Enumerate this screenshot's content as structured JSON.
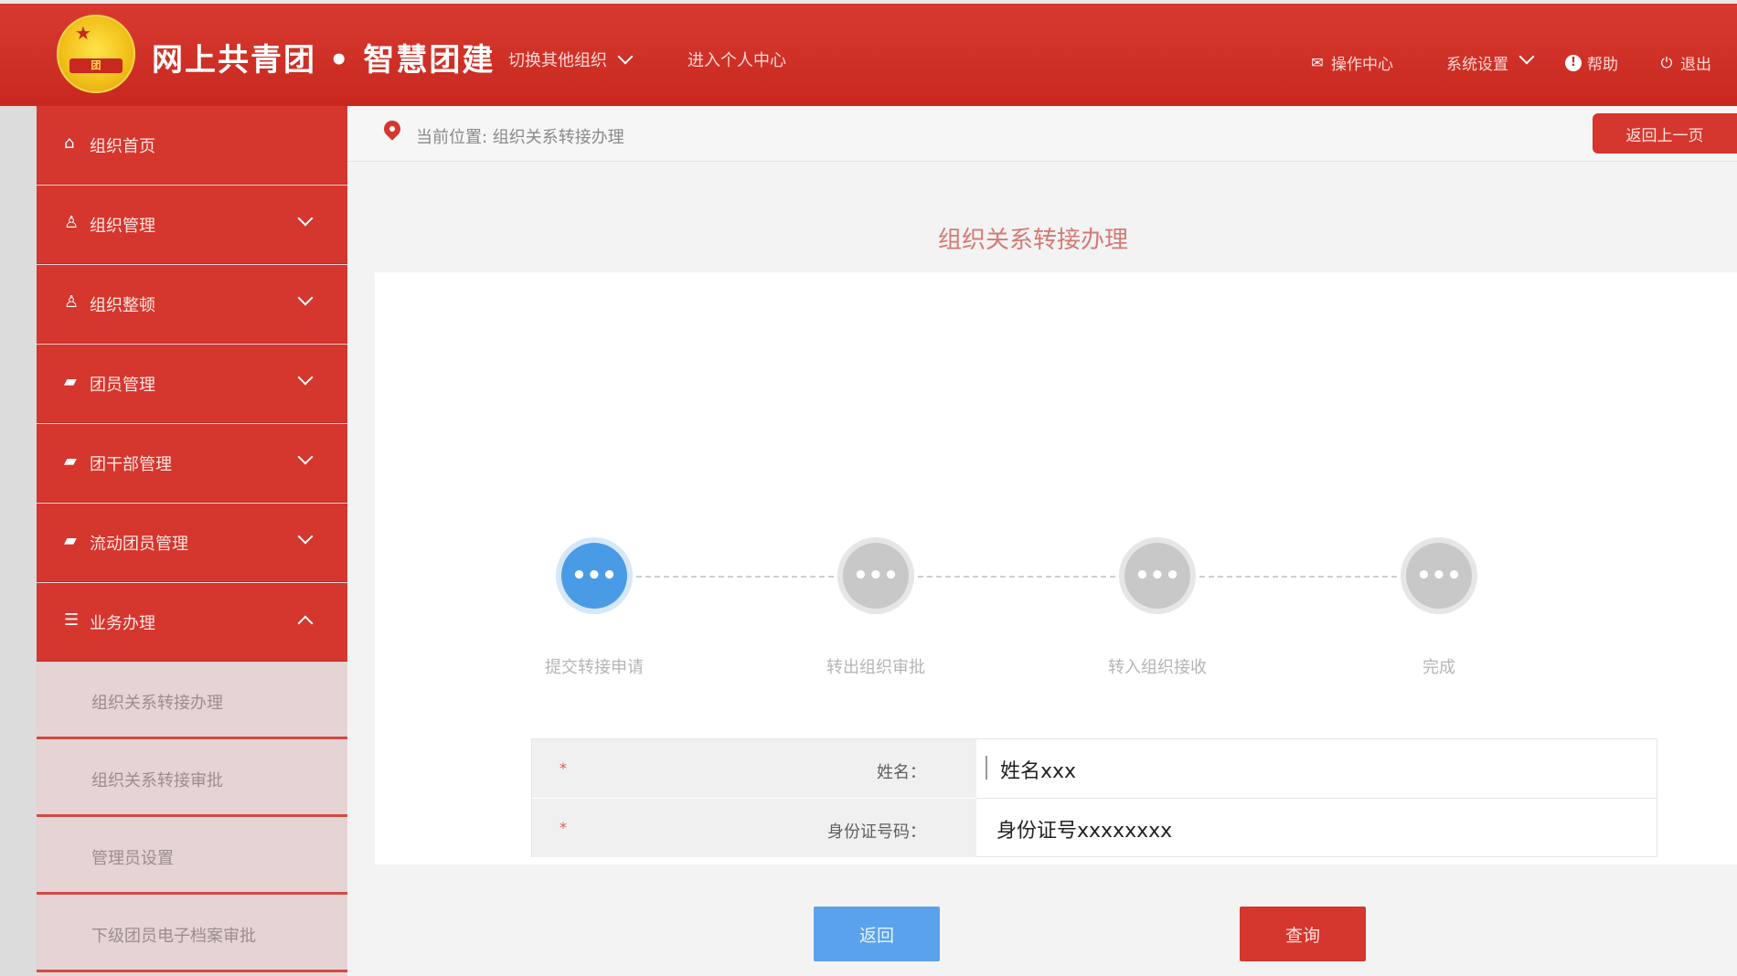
{
  "header": {
    "site_title": "网上共青团 • 智慧团建",
    "nav": [
      {
        "label": "切换其他组织"
      },
      {
        "label": "进入个人中心"
      }
    ],
    "right": [
      {
        "icon": "mail-icon",
        "label": "操作中心"
      },
      {
        "icon": "gear-icon",
        "label": "系统设置"
      },
      {
        "icon": "help-icon",
        "label": "帮助"
      },
      {
        "icon": "power-icon",
        "label": "退出"
      }
    ]
  },
  "sidebar": {
    "items": [
      {
        "label": "组织首页",
        "icon": "home-icon",
        "has_chevron": false
      },
      {
        "label": "组织管理",
        "icon": "org-tree-icon",
        "has_chevron": true
      },
      {
        "label": "组织整顿",
        "icon": "org-tree-icon",
        "has_chevron": true
      },
      {
        "label": "团员管理",
        "icon": "shirt-icon",
        "has_chevron": true
      },
      {
        "label": "团干部管理",
        "icon": "shirt-icon",
        "has_chevron": true
      },
      {
        "label": "流动团员管理",
        "icon": "shirt-icon",
        "has_chevron": true
      },
      {
        "label": "业务办理",
        "icon": "list-icon",
        "has_chevron": true,
        "expanded": true
      }
    ],
    "subitems": [
      {
        "label": "组织关系转接办理"
      },
      {
        "label": "组织关系转接审批"
      },
      {
        "label": "管理员设置"
      },
      {
        "label": "下级团员电子档案审批"
      }
    ]
  },
  "breadcrumb": {
    "text": "当前位置: 组织关系转接办理",
    "back_button": "返回上一页"
  },
  "page": {
    "title": "组织关系转接办理"
  },
  "steps": [
    {
      "label": "提交转接申请",
      "state": "active"
    },
    {
      "label": "转出组织审批",
      "state": "pending"
    },
    {
      "label": "转入组织接收",
      "state": "pending"
    },
    {
      "label": "完成",
      "state": "pending"
    }
  ],
  "step_icon_text": "•••",
  "form": {
    "fields": [
      {
        "label": "姓名：",
        "value": "姓名xxx",
        "required_mark": "*"
      },
      {
        "label": "身份证号码：",
        "value": "身份证号xxxxxxxx",
        "required_mark": "*"
      }
    ]
  },
  "buttons": {
    "return": "返回",
    "query": "查询"
  },
  "colors": {
    "brand_red": "#d5362d",
    "active_step_blue": "#4a9be6",
    "return_button_blue": "#5ba2ec"
  }
}
